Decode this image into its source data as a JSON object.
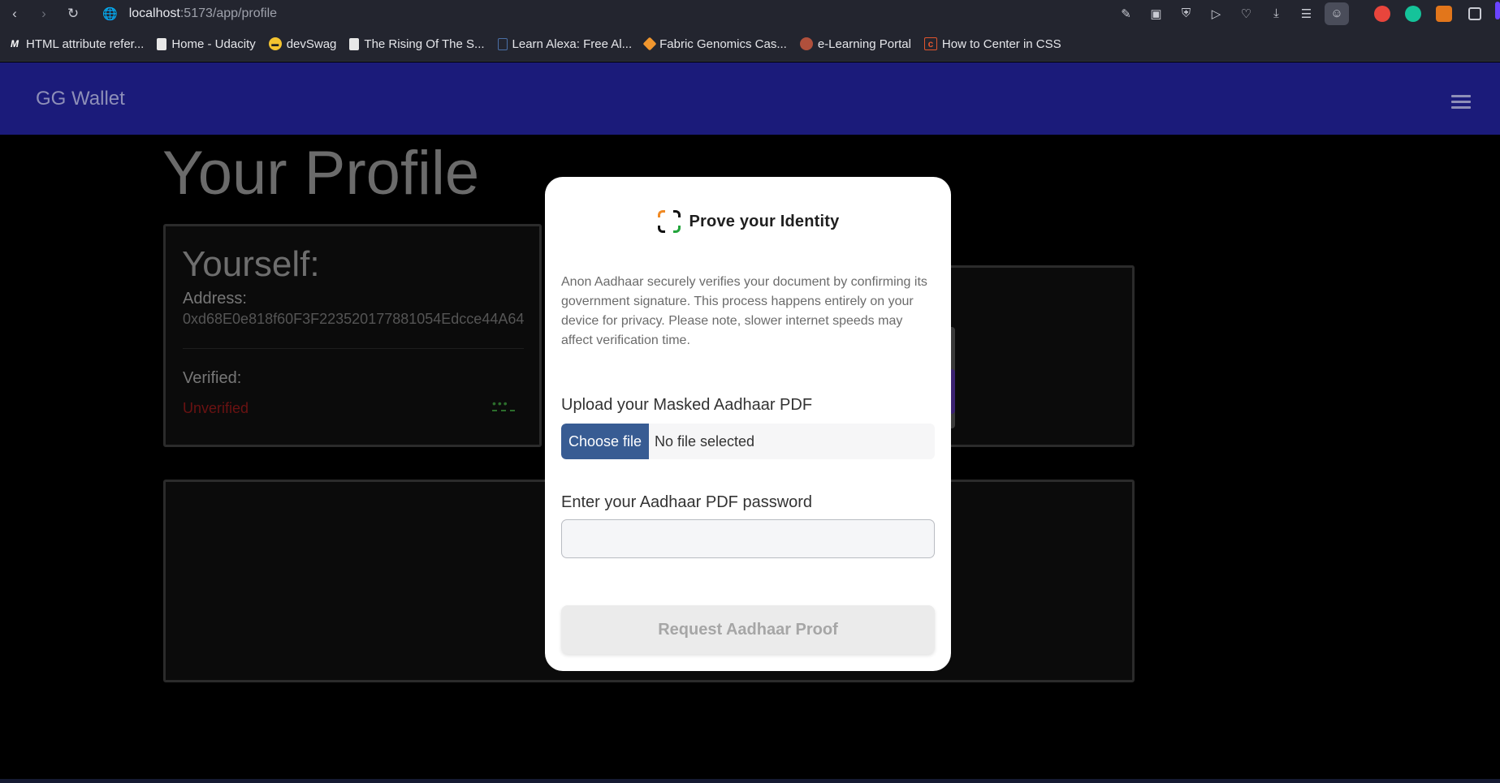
{
  "browser": {
    "url_host": "localhost",
    "url_path": ":5173/app/profile",
    "bookmarks": [
      {
        "label": "HTML attribute refer...",
        "icon": "mdn-icon"
      },
      {
        "label": "Home - Udacity",
        "icon": "page-icon"
      },
      {
        "label": "devSwag",
        "icon": "sunglasses-emoji-icon"
      },
      {
        "label": "The Rising Of The S...",
        "icon": "page-icon"
      },
      {
        "label": "Learn Alexa: Free Al...",
        "icon": "alexa-icon"
      },
      {
        "label": "Fabric Genomics Cas...",
        "icon": "cube-icon"
      },
      {
        "label": "e-Learning Portal",
        "icon": "portal-icon"
      },
      {
        "label": "How to Center in CSS",
        "icon": "c-icon"
      }
    ]
  },
  "app": {
    "brand": "GG Wallet",
    "page_title": "Your Profile",
    "profile_card": {
      "heading": "Yourself:",
      "address_label": "Address:",
      "address": "0xd68E0e818f60F3F223520177881054Edcce44A64",
      "verified_label": "Verified:",
      "status": "Unverified",
      "dots": "•••"
    }
  },
  "modal": {
    "title": "Prove your Identity",
    "description": "Anon Aadhaar securely verifies your document by confirming its government signature. This process happens entirely on your device for privacy. Please note, slower internet speeds may affect verification time.",
    "upload_label": "Upload your Masked Aadhaar PDF",
    "choose_file": "Choose file",
    "no_file": "No file selected",
    "password_label": "Enter your Aadhaar PDF password",
    "password_value": "",
    "submit": "Request Aadhaar Proof"
  },
  "colors": {
    "appbar": "#1b1b7a",
    "choose_button": "#385c93",
    "unverified": "#6a1212"
  }
}
